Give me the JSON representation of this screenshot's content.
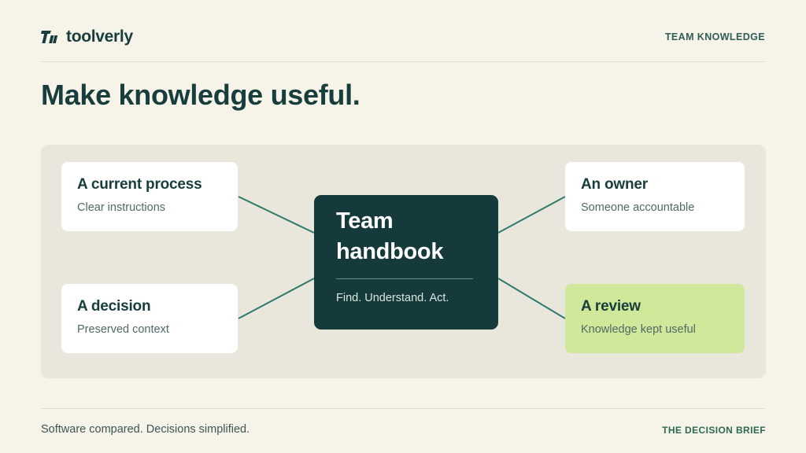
{
  "brand": {
    "name": "toolverly",
    "icon": "tv-logo-icon"
  },
  "header": {
    "tag": "TEAM KNOWLEDGE"
  },
  "title": "Make knowledge useful.",
  "diagram": {
    "center": {
      "title_line1": "Team",
      "title_line2": "handbook",
      "subtitle": "Find. Understand. Act."
    },
    "nodes": [
      {
        "title": "A current process",
        "subtitle": "Clear instructions",
        "position": "top-left",
        "highlighted": false
      },
      {
        "title": "A decision",
        "subtitle": "Preserved context",
        "position": "bottom-left",
        "highlighted": false
      },
      {
        "title": "An owner",
        "subtitle": "Someone accountable",
        "position": "top-right",
        "highlighted": false
      },
      {
        "title": "A review",
        "subtitle": "Knowledge kept useful",
        "position": "bottom-right",
        "highlighted": true
      }
    ]
  },
  "footer": {
    "tagline": "Software compared. Decisions simplified.",
    "brand_line": "THE DECISION BRIEF"
  },
  "colors": {
    "background": "#f6f3e9",
    "panel": "#e9e7db",
    "hub": "#143a3b",
    "connector": "#2f7a6c",
    "highlight": "#cfe89a",
    "text_dark": "#173d3c",
    "footer_accent": "#2d6a4f"
  }
}
